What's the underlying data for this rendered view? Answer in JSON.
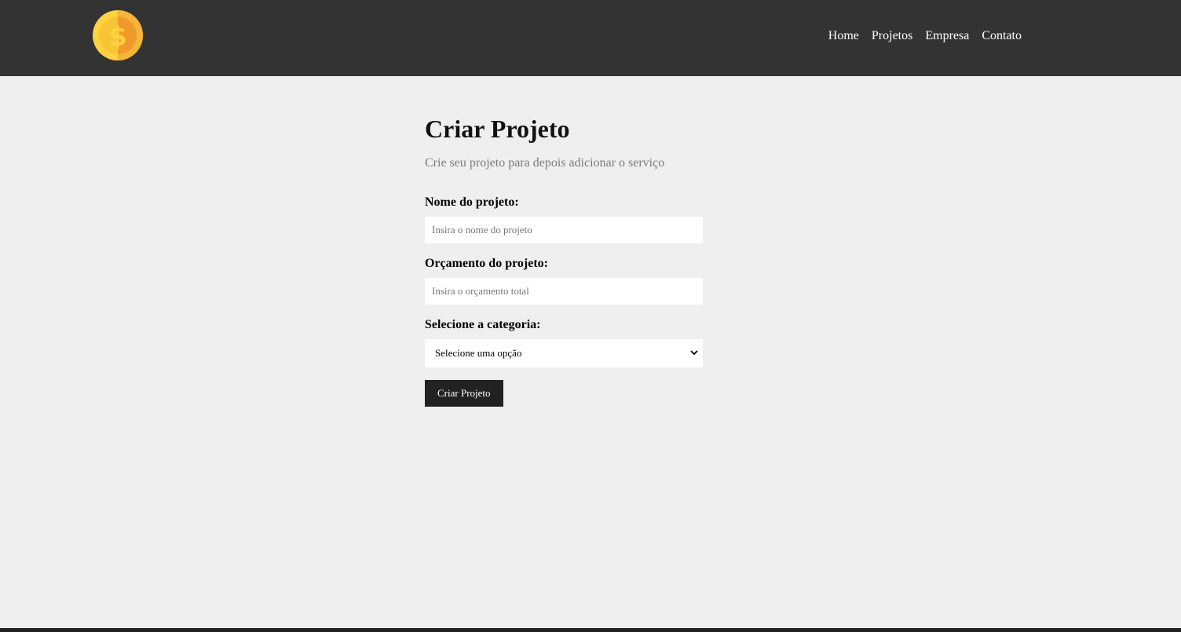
{
  "nav": {
    "logo_icon": "dollar-coin-icon",
    "items": [
      {
        "label": "Home"
      },
      {
        "label": "Projetos"
      },
      {
        "label": "Empresa"
      },
      {
        "label": "Contato"
      }
    ]
  },
  "page": {
    "title": "Criar Projeto",
    "subtitle": "Crie seu projeto para depois adicionar o serviço"
  },
  "form": {
    "name_label": "Nome do projeto:",
    "name_placeholder": "Insira o nome do projeto",
    "budget_label": "Orçamento do projeto:",
    "budget_placeholder": "Insira o orçamento total",
    "category_label": "Selecione a categoria:",
    "category_selected": "Selecione uma opção",
    "submit_label": "Criar Projeto"
  },
  "colors": {
    "navbar": "#333333",
    "background": "#efefef",
    "button": "#222222",
    "coin_outer": "#ffd340",
    "coin_inner": "#f0a030"
  }
}
